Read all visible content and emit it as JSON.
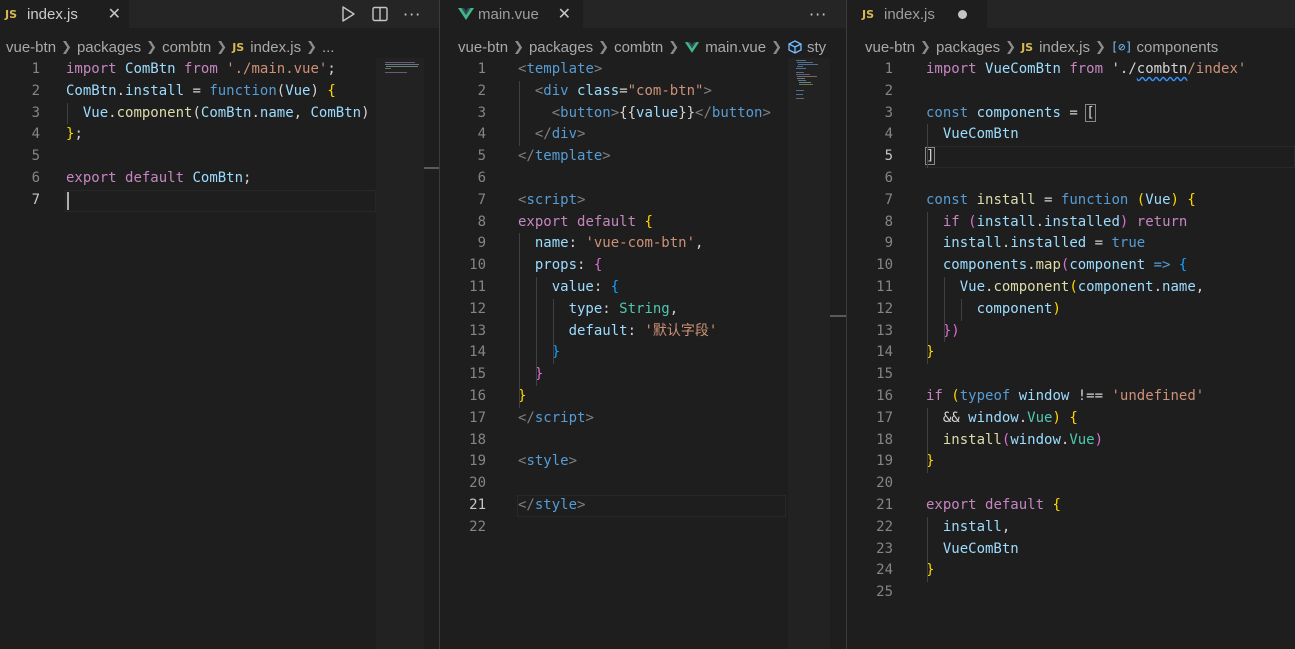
{
  "panes": [
    {
      "tab": {
        "name": "index.js",
        "icon": "js-icon",
        "modified": false
      },
      "breadcrumb": [
        "vue-btn",
        "packages",
        "combtn",
        "index.js",
        "..."
      ],
      "active_line": 7,
      "lines": [
        [
          {
            "t": "import",
            "c": "kw"
          },
          {
            "t": " "
          },
          {
            "t": "ComBtn",
            "c": "vr"
          },
          {
            "t": " "
          },
          {
            "t": "from",
            "c": "kw"
          },
          {
            "t": " "
          },
          {
            "t": "'./main.vue'",
            "c": "s"
          },
          {
            "t": ";"
          }
        ],
        [
          {
            "t": "ComBtn",
            "c": "vr"
          },
          {
            "t": "."
          },
          {
            "t": "install",
            "c": "vr"
          },
          {
            "t": " = "
          },
          {
            "t": "function",
            "c": "st"
          },
          {
            "t": "("
          },
          {
            "t": "Vue",
            "c": "vr"
          },
          {
            "t": ") "
          },
          {
            "t": "{",
            "c": "b1"
          }
        ],
        [
          {
            "t": "  "
          },
          {
            "t": "Vue",
            "c": "vr"
          },
          {
            "t": "."
          },
          {
            "t": "component",
            "c": "fn"
          },
          {
            "t": "("
          },
          {
            "t": "ComBtn",
            "c": "vr"
          },
          {
            "t": "."
          },
          {
            "t": "name",
            "c": "vr"
          },
          {
            "t": ", "
          },
          {
            "t": "ComBtn",
            "c": "vr"
          },
          {
            "t": ")"
          }
        ],
        [
          {
            "t": "}",
            "c": "b1"
          },
          {
            "t": ";"
          }
        ],
        [],
        [
          {
            "t": "export",
            "c": "kw"
          },
          {
            "t": " "
          },
          {
            "t": "default",
            "c": "kw"
          },
          {
            "t": " "
          },
          {
            "t": "ComBtn",
            "c": "vr"
          },
          {
            "t": ";"
          }
        ],
        []
      ]
    },
    {
      "tab": {
        "name": "main.vue",
        "icon": "vue-icon",
        "modified": false
      },
      "breadcrumb": [
        "vue-btn",
        "packages",
        "combtn",
        "main.vue",
        "sty"
      ],
      "active_line": 21,
      "lines": [
        [
          {
            "t": "<",
            "c": "gr"
          },
          {
            "t": "template",
            "c": "tg"
          },
          {
            "t": ">",
            "c": "gr"
          }
        ],
        [
          {
            "t": "  "
          },
          {
            "t": "<",
            "c": "gr"
          },
          {
            "t": "div",
            "c": "tg"
          },
          {
            "t": " "
          },
          {
            "t": "class",
            "c": "at"
          },
          {
            "t": "="
          },
          {
            "t": "\"com-btn\"",
            "c": "s"
          },
          {
            "t": ">",
            "c": "gr"
          }
        ],
        [
          {
            "t": "    "
          },
          {
            "t": "<",
            "c": "gr"
          },
          {
            "t": "button",
            "c": "tg"
          },
          {
            "t": ">",
            "c": "gr"
          },
          {
            "t": "{{",
            "c": "p"
          },
          {
            "t": "value",
            "c": "vr"
          },
          {
            "t": "}}",
            "c": "p"
          },
          {
            "t": "</",
            "c": "gr"
          },
          {
            "t": "button",
            "c": "tg"
          },
          {
            "t": ">",
            "c": "gr"
          }
        ],
        [
          {
            "t": "  "
          },
          {
            "t": "</",
            "c": "gr"
          },
          {
            "t": "div",
            "c": "tg"
          },
          {
            "t": ">",
            "c": "gr"
          }
        ],
        [
          {
            "t": "</",
            "c": "gr"
          },
          {
            "t": "template",
            "c": "tg"
          },
          {
            "t": ">",
            "c": "gr"
          }
        ],
        [],
        [
          {
            "t": "<",
            "c": "gr"
          },
          {
            "t": "script",
            "c": "tg"
          },
          {
            "t": ">",
            "c": "gr"
          }
        ],
        [
          {
            "t": "export",
            "c": "kw"
          },
          {
            "t": " "
          },
          {
            "t": "default",
            "c": "kw"
          },
          {
            "t": " "
          },
          {
            "t": "{",
            "c": "b1"
          }
        ],
        [
          {
            "t": "  "
          },
          {
            "t": "name",
            "c": "vr"
          },
          {
            "t": ": "
          },
          {
            "t": "'vue-com-btn'",
            "c": "s"
          },
          {
            "t": ","
          }
        ],
        [
          {
            "t": "  "
          },
          {
            "t": "props",
            "c": "vr"
          },
          {
            "t": ": "
          },
          {
            "t": "{",
            "c": "b2"
          }
        ],
        [
          {
            "t": "    "
          },
          {
            "t": "value",
            "c": "vr"
          },
          {
            "t": ": "
          },
          {
            "t": "{",
            "c": "b3"
          }
        ],
        [
          {
            "t": "      "
          },
          {
            "t": "type",
            "c": "vr"
          },
          {
            "t": ": "
          },
          {
            "t": "String",
            "c": "ty"
          },
          {
            "t": ","
          }
        ],
        [
          {
            "t": "      "
          },
          {
            "t": "default",
            "c": "vr"
          },
          {
            "t": ": "
          },
          {
            "t": "'默认字段'",
            "c": "s"
          }
        ],
        [
          {
            "t": "    "
          },
          {
            "t": "}",
            "c": "b3"
          }
        ],
        [
          {
            "t": "  "
          },
          {
            "t": "}",
            "c": "b2"
          }
        ],
        [
          {
            "t": "}",
            "c": "b1"
          }
        ],
        [
          {
            "t": "</",
            "c": "gr"
          },
          {
            "t": "script",
            "c": "tg"
          },
          {
            "t": ">",
            "c": "gr"
          }
        ],
        [],
        [
          {
            "t": "<",
            "c": "gr"
          },
          {
            "t": "style",
            "c": "tg"
          },
          {
            "t": ">",
            "c": "gr"
          }
        ],
        [],
        [
          {
            "t": "</",
            "c": "gr"
          },
          {
            "t": "style",
            "c": "tg"
          },
          {
            "t": ">",
            "c": "gr"
          }
        ],
        []
      ]
    },
    {
      "tab": {
        "name": "index.js",
        "icon": "js-icon",
        "modified": true
      },
      "breadcrumb": [
        "vue-btn",
        "packages",
        "index.js",
        "components"
      ],
      "active_line": 5,
      "lines": [
        [
          {
            "t": "import",
            "c": "kw"
          },
          {
            "t": " "
          },
          {
            "t": "VueComBtn",
            "c": "vr"
          },
          {
            "t": " "
          },
          {
            "t": "from",
            "c": "kw"
          },
          {
            "t": " "
          },
          {
            "t": "'./"
          },
          {
            "t": "combtn",
            "c": "squig"
          },
          {
            "t": "/index'",
            "c": "s"
          }
        ],
        [],
        [
          {
            "t": "const",
            "c": "st"
          },
          {
            "t": " "
          },
          {
            "t": "components",
            "c": "vr"
          },
          {
            "t": " = "
          },
          {
            "t": "[",
            "c": "bm"
          }
        ],
        [
          {
            "t": "  "
          },
          {
            "t": "VueComBtn",
            "c": "vr"
          }
        ],
        [
          {
            "t": "]",
            "c": "bm"
          }
        ],
        [],
        [
          {
            "t": "const",
            "c": "st"
          },
          {
            "t": " "
          },
          {
            "t": "install",
            "c": "fn"
          },
          {
            "t": " = "
          },
          {
            "t": "function",
            "c": "st"
          },
          {
            "t": " "
          },
          {
            "t": "(",
            "c": "b1"
          },
          {
            "t": "Vue",
            "c": "vr"
          },
          {
            "t": ")",
            "c": "b1"
          },
          {
            "t": " "
          },
          {
            "t": "{",
            "c": "b1"
          }
        ],
        [
          {
            "t": "  "
          },
          {
            "t": "if",
            "c": "kw"
          },
          {
            "t": " "
          },
          {
            "t": "(",
            "c": "b2"
          },
          {
            "t": "install",
            "c": "vr"
          },
          {
            "t": "."
          },
          {
            "t": "installed",
            "c": "vr"
          },
          {
            "t": ")",
            "c": "b2"
          },
          {
            "t": " "
          },
          {
            "t": "return",
            "c": "kw"
          }
        ],
        [
          {
            "t": "  "
          },
          {
            "t": "install",
            "c": "vr"
          },
          {
            "t": "."
          },
          {
            "t": "installed",
            "c": "vr"
          },
          {
            "t": " = "
          },
          {
            "t": "true",
            "c": "st"
          }
        ],
        [
          {
            "t": "  "
          },
          {
            "t": "components",
            "c": "vr"
          },
          {
            "t": "."
          },
          {
            "t": "map",
            "c": "fn"
          },
          {
            "t": "(",
            "c": "b2"
          },
          {
            "t": "component",
            "c": "vr"
          },
          {
            "t": " "
          },
          {
            "t": "=>",
            "c": "st"
          },
          {
            "t": " "
          },
          {
            "t": "{",
            "c": "b3"
          }
        ],
        [
          {
            "t": "    "
          },
          {
            "t": "Vue",
            "c": "vr"
          },
          {
            "t": "."
          },
          {
            "t": "component",
            "c": "fn"
          },
          {
            "t": "(",
            "c": "b1"
          },
          {
            "t": "component",
            "c": "vr"
          },
          {
            "t": "."
          },
          {
            "t": "name",
            "c": "vr"
          },
          {
            "t": ","
          }
        ],
        [
          {
            "t": "      "
          },
          {
            "t": "component",
            "c": "vr"
          },
          {
            "t": ")",
            "c": "b1"
          }
        ],
        [
          {
            "t": "  "
          },
          {
            "t": "})",
            "c": "b2"
          }
        ],
        [
          {
            "t": "}",
            "c": "b1"
          }
        ],
        [],
        [
          {
            "t": "if",
            "c": "kw"
          },
          {
            "t": " "
          },
          {
            "t": "(",
            "c": "b1"
          },
          {
            "t": "typeof",
            "c": "st"
          },
          {
            "t": " "
          },
          {
            "t": "window",
            "c": "vr"
          },
          {
            "t": " !== "
          },
          {
            "t": "'undefined'",
            "c": "s"
          }
        ],
        [
          {
            "t": "  && "
          },
          {
            "t": "window",
            "c": "vr"
          },
          {
            "t": "."
          },
          {
            "t": "Vue",
            "c": "ty"
          },
          {
            "t": ")",
            "c": "b1"
          },
          {
            "t": " "
          },
          {
            "t": "{",
            "c": "b1"
          }
        ],
        [
          {
            "t": "  "
          },
          {
            "t": "install",
            "c": "fn"
          },
          {
            "t": "(",
            "c": "b2"
          },
          {
            "t": "window",
            "c": "vr"
          },
          {
            "t": "."
          },
          {
            "t": "Vue",
            "c": "ty"
          },
          {
            "t": ")",
            "c": "b2"
          }
        ],
        [
          {
            "t": "}",
            "c": "b1"
          }
        ],
        [],
        [
          {
            "t": "export",
            "c": "kw"
          },
          {
            "t": " "
          },
          {
            "t": "default",
            "c": "kw"
          },
          {
            "t": " "
          },
          {
            "t": "{",
            "c": "b1"
          }
        ],
        [
          {
            "t": "  "
          },
          {
            "t": "install",
            "c": "vr"
          },
          {
            "t": ","
          }
        ],
        [
          {
            "t": "  "
          },
          {
            "t": "VueComBtn",
            "c": "vr"
          }
        ],
        [
          {
            "t": "}",
            "c": "b1"
          }
        ],
        []
      ]
    }
  ],
  "actions": {
    "run": "run-icon",
    "split": "split-editor-icon",
    "more": "···"
  },
  "colors": {
    "background": "#1e1e1e",
    "tabbar": "#252526",
    "keyword": "#c586c0",
    "storage": "#569cd6",
    "variable": "#9cdcfe",
    "function": "#dcdcaa",
    "string": "#ce9178",
    "type": "#4ec9b0",
    "js_icon": "#d7ba4f",
    "vue_icon": "#41b883"
  }
}
